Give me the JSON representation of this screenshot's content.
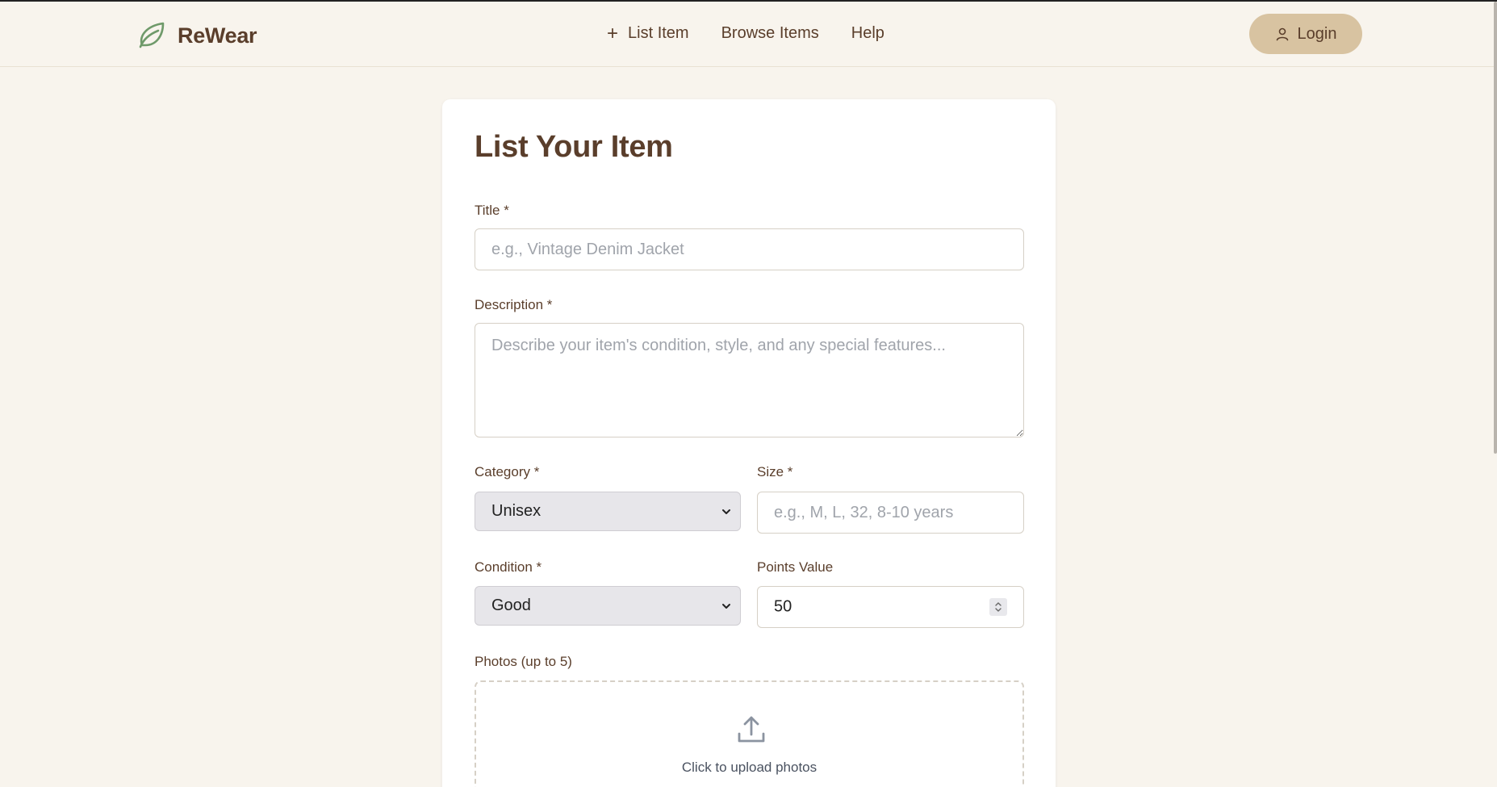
{
  "header": {
    "brand": "ReWear",
    "nav": [
      {
        "label": "List Item",
        "icon": "plus-icon"
      },
      {
        "label": "Browse Items"
      },
      {
        "label": "Help"
      }
    ],
    "login_label": "Login"
  },
  "form": {
    "title": "List Your Item",
    "title_field": {
      "label": "Title *",
      "placeholder": "e.g., Vintage Denim Jacket",
      "value": ""
    },
    "description_field": {
      "label": "Description *",
      "placeholder": "Describe your item's condition, style, and any special features...",
      "value": ""
    },
    "category_field": {
      "label": "Category *",
      "value": "Unisex"
    },
    "size_field": {
      "label": "Size *",
      "placeholder": "e.g., M, L, 32, 8-10 years",
      "value": ""
    },
    "condition_field": {
      "label": "Condition *",
      "value": "Good"
    },
    "points_field": {
      "label": "Points Value",
      "value": "50"
    },
    "photos": {
      "label": "Photos (up to 5)",
      "upload_text": "Click to upload photos"
    }
  },
  "colors": {
    "background": "#f8f4ed",
    "text_brown": "#5a3e2b",
    "brand_green": "#6f9a6a",
    "login_bg": "#d8c3a1"
  }
}
